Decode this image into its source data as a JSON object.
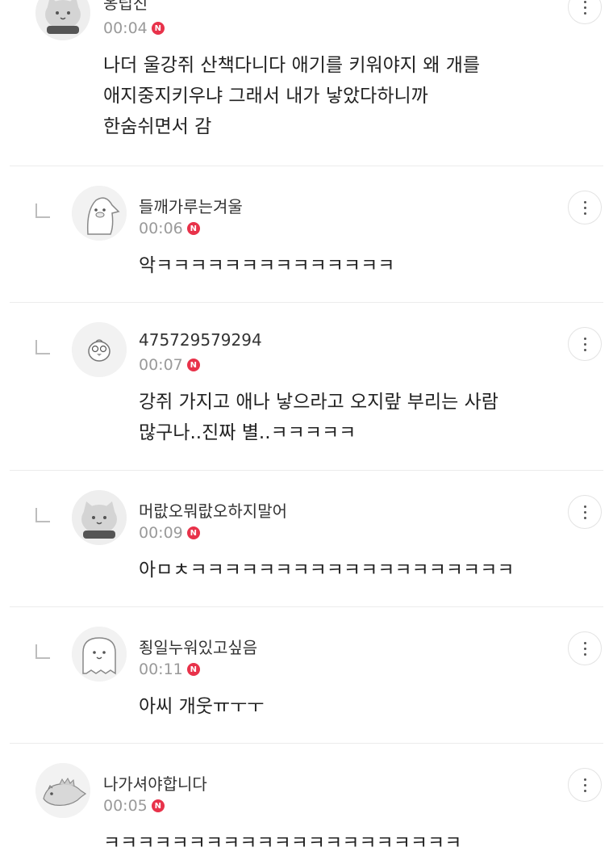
{
  "comments": [
    {
      "nickname": "옹립진",
      "time": "00:04",
      "badge": "N",
      "is_reply": false,
      "avatar_icon": "cat-avatar-icon",
      "text": "나더 울강쥐 산책다니다 애기를 키워야지 왜 개를\n애지중지키우냐 그래서 내가 낳았다하니까\n한숨쉬면서 감"
    },
    {
      "nickname": "들깨가루는겨울",
      "time": "00:06",
      "badge": "N",
      "is_reply": true,
      "avatar_icon": "penguin-avatar-icon",
      "text": "악ㅋㅋㅋㅋㅋㅋㅋㅋㅋㅋㅋㅋㅋㅋ"
    },
    {
      "nickname": "475729579294",
      "time": "00:07",
      "badge": "N",
      "is_reply": true,
      "avatar_icon": "chick-avatar-icon",
      "text": "강쥐 가지고 애나 낳으라고 오지랖 부리는 사람\n많구나..진짜 별..ㅋㅋㅋㅋㅋ"
    },
    {
      "nickname": "머랎오뭐랎오하지말어",
      "time": "00:09",
      "badge": "N",
      "is_reply": true,
      "avatar_icon": "cat-avatar-icon",
      "text": "아ㅁㅊㅋㅋㅋㅋㅋㅋㅋㅋㅋㅋㅋㅋㅋㅋㅋㅋㅋㅋㅋ"
    },
    {
      "nickname": "죙일누워있고싶음",
      "time": "00:11",
      "badge": "N",
      "is_reply": true,
      "avatar_icon": "ghost-avatar-icon",
      "text": "아씨 개웃ㅠㅜㅜ"
    },
    {
      "nickname": "나가셔야합니다",
      "time": "00:05",
      "badge": "N",
      "is_reply": false,
      "avatar_icon": "dinosaur-avatar-icon",
      "text": "ㅋㅋㅋㅋㅋㅋㅋㅋㅋㅋㅋㅋㅋㅋㅋㅋㅋㅋㅋㅋㅋ"
    }
  ],
  "colors": {
    "badge": "#e8324a",
    "time": "#9a9a9a",
    "divider": "#ececec"
  },
  "icons": {
    "more": "more-vertical-icon",
    "reply": "reply-arrow-icon"
  }
}
